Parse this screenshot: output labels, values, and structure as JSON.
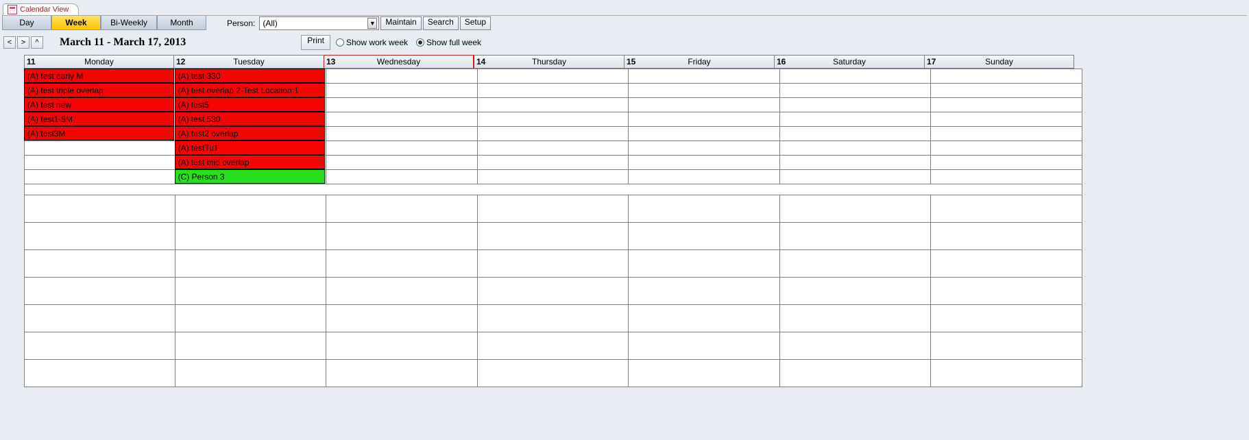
{
  "tab": {
    "title": "Calendar View"
  },
  "views": {
    "day": "Day",
    "week": "Week",
    "biweekly": "Bi-Weekly",
    "month": "Month",
    "active": "week"
  },
  "person": {
    "label": "Person:",
    "value": "(All)"
  },
  "actions": {
    "maintain": "Maintain",
    "search": "Search",
    "setup": "Setup"
  },
  "nav": {
    "prev": "<",
    "next": ">",
    "up": "^"
  },
  "dateRange": "March 11 - March 17, 2013",
  "print": "Print",
  "weekMode": {
    "work": "Show work week",
    "full": "Show full week",
    "selected": "full"
  },
  "days": [
    {
      "num": "11",
      "name": "Monday"
    },
    {
      "num": "12",
      "name": "Tuesday"
    },
    {
      "num": "13",
      "name": "Wednesday",
      "selected": true
    },
    {
      "num": "14",
      "name": "Thursday"
    },
    {
      "num": "15",
      "name": "Friday"
    },
    {
      "num": "16",
      "name": "Saturday"
    },
    {
      "num": "17",
      "name": "Sunday"
    }
  ],
  "events": {
    "monday": [
      {
        "text": "(A) test early M",
        "color": "red"
      },
      {
        "text": "(A) test triple overlap",
        "color": "red"
      },
      {
        "text": "(A) test new",
        "color": "red"
      },
      {
        "text": "(A) test1-5M",
        "color": "red"
      },
      {
        "text": "(A) test3M",
        "color": "red"
      }
    ],
    "tuesday": [
      {
        "text": "(A) test 330",
        "color": "red"
      },
      {
        "text": "(A) test overlap 2-Test Location 1",
        "color": "red"
      },
      {
        "text": "(A) test5",
        "color": "red"
      },
      {
        "text": "(A) test 530",
        "color": "red"
      },
      {
        "text": "(A) test2 overlap",
        "color": "red"
      },
      {
        "text": "(A) testTu1",
        "color": "red"
      },
      {
        "text": "(A) test mid overlap",
        "color": "red"
      },
      {
        "text": "(C) Person 3",
        "color": "green"
      }
    ]
  },
  "grid": {
    "smallRows": 8,
    "bigRows": 7
  },
  "colors": {
    "red": "#f60404",
    "green": "#25e01b",
    "accent": "#ffc400"
  }
}
